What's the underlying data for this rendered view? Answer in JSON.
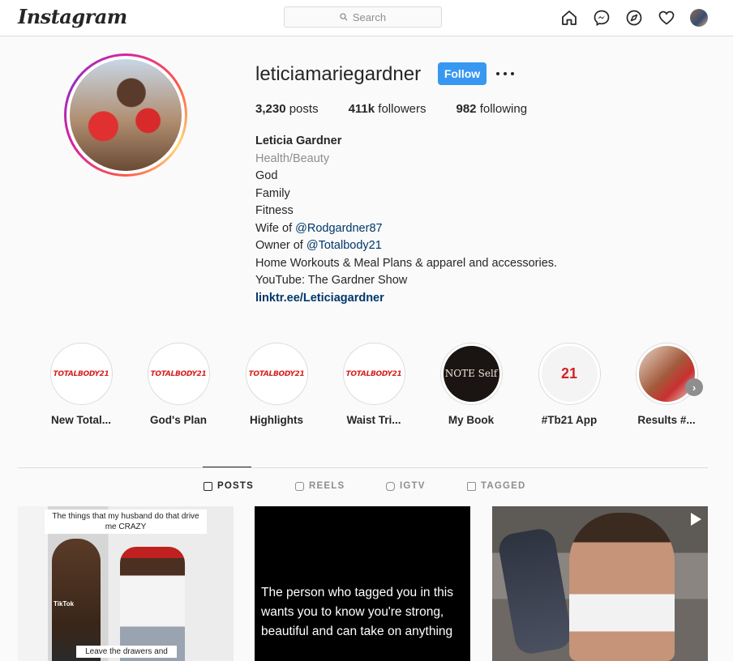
{
  "nav": {
    "logo": "Instagram",
    "search_placeholder": "Search",
    "icons": [
      "home-icon",
      "messenger-icon",
      "explore-icon",
      "heart-icon",
      "profile-avatar"
    ]
  },
  "profile": {
    "username": "leticiamariegardner",
    "follow_label": "Follow",
    "posts_count": "3,230",
    "posts_label": "posts",
    "followers_count": "411k",
    "followers_label": "followers",
    "following_count": "982",
    "following_label": "following",
    "full_name": "Leticia Gardner",
    "category": "Health/Beauty",
    "bio": {
      "line1": "God",
      "line2": "Family",
      "line3": "Fitness",
      "wife_prefix": "Wife of ",
      "wife_mention": "@Rodgardner87",
      "owner_prefix": "Owner of ",
      "owner_mention": "@Totalbody21",
      "line6": "Home Workouts & Meal Plans & apparel and accessories.",
      "line7": "YouTube: The Gardner Show"
    },
    "link": "linktr.ee/Leticiagardner"
  },
  "highlights": [
    {
      "label": "New Total...",
      "inner": "TOTALBODY21"
    },
    {
      "label": "God's Plan",
      "inner": "TOTALBODY21"
    },
    {
      "label": "Highlights",
      "inner": "TOTALBODY21"
    },
    {
      "label": "Waist Tri...",
      "inner": "TOTALBODY21"
    },
    {
      "label": "My Book",
      "inner": "NOTE Self"
    },
    {
      "label": "#Tb21 App",
      "inner": "21"
    },
    {
      "label": "Results #...",
      "inner": ""
    }
  ],
  "tabs": [
    {
      "label": "POSTS",
      "active": true
    },
    {
      "label": "REELS",
      "active": false
    },
    {
      "label": "IGTV",
      "active": false
    },
    {
      "label": "TAGGED",
      "active": false
    }
  ],
  "posts": {
    "p1_top": "The things that my husband do that drive me CRAZY",
    "p1_bottom": "Leave the drawers and",
    "p1_tiktok": "TikTok",
    "p2_text": "The person who tagged you in this wants you to know you're strong, beautiful and can take on anything"
  },
  "colors": {
    "follow_button": "#3897f0",
    "link": "#00376b",
    "border": "#dbdbdb",
    "muted": "#8e8e8e"
  }
}
